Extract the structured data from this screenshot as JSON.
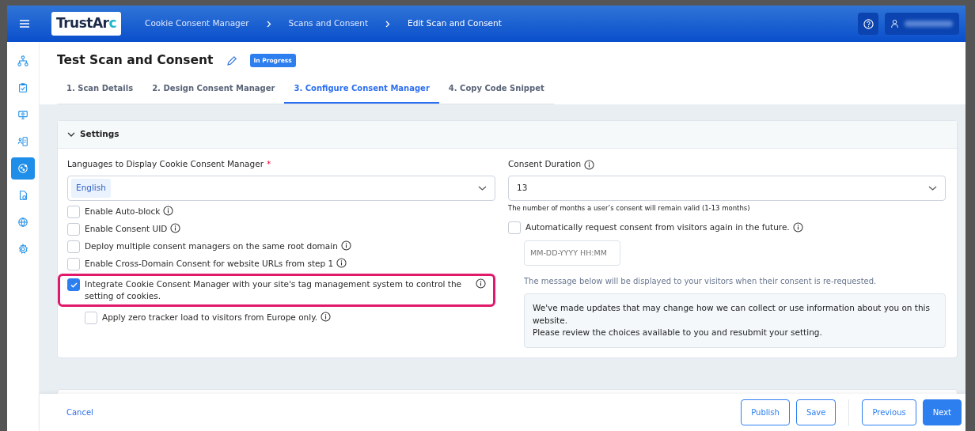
{
  "topbar": {
    "logo": "TrustArc",
    "breadcrumbs": [
      "Cookie Consent Manager",
      "Scans and Consent",
      "Edit Scan and Consent"
    ]
  },
  "sidebar": {
    "items": [
      {
        "selected": false
      },
      {
        "selected": false
      },
      {
        "selected": false
      },
      {
        "selected": false
      },
      {
        "selected": true
      },
      {
        "selected": false
      },
      {
        "selected": false
      },
      {
        "selected": false
      }
    ]
  },
  "page": {
    "title": "Test Scan and Consent",
    "status": "In Progress"
  },
  "tabs": [
    {
      "label": "1. Scan Details",
      "selected": false
    },
    {
      "label": "2. Design Consent Manager",
      "selected": false
    },
    {
      "label": "3. Configure Consent Manager",
      "selected": true
    },
    {
      "label": "4. Copy Code Snippet",
      "selected": false
    }
  ],
  "settings": {
    "title": "Settings",
    "expanded": true,
    "languages": {
      "label": "Languages to Display Cookie Consent Manager",
      "required": "*",
      "chips": [
        "English"
      ]
    },
    "options": [
      {
        "label": "Enable Auto-block",
        "checked": false,
        "highlighted": false
      },
      {
        "label": "Enable Consent UID",
        "checked": false,
        "highlighted": false
      },
      {
        "label": "Deploy multiple consent managers on the same root domain",
        "checked": false,
        "highlighted": false
      },
      {
        "label": "Enable Cross-Domain Consent for website URLs from step 1",
        "checked": false,
        "highlighted": false
      },
      {
        "label": "Integrate Cookie Consent Manager with your site's tag management system to control the setting of cookies.",
        "checked": true,
        "highlighted": true,
        "children": [
          {
            "label": "Apply zero tracker load to visitors from Europe only.",
            "checked": false,
            "highlighted": false
          }
        ]
      }
    ],
    "duration": {
      "label": "Consent Duration",
      "value": "13",
      "help": "The number of months a user’s consent will remain valid (1-13 months)"
    },
    "rerequest": {
      "label": "Automatically request consent from visitors again in the future.",
      "checked": false,
      "placeholder": "MM-DD-YYYY HH:MM",
      "note": "The message below will be displayed to your visitors when their consent is re-requested.",
      "message": [
        "We've made updates that may change how we can collect or use information about you on this website.",
        "Please review the choices available to you and resubmit your setting."
      ]
    }
  },
  "footer": {
    "cancel": "Cancel",
    "buttons": [
      {
        "label": "Publish",
        "kind": "outline"
      },
      {
        "label": "Save",
        "kind": "outline"
      },
      {
        "label": "Previous",
        "kind": "outline"
      },
      {
        "label": "Next",
        "kind": "primary"
      }
    ]
  }
}
